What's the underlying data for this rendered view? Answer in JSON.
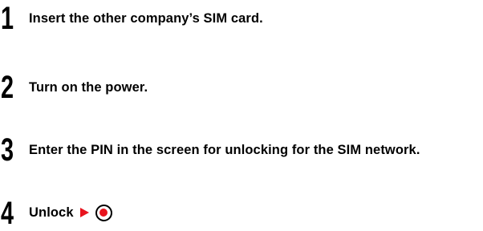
{
  "steps": [
    {
      "number": "1",
      "text": "Insert the other company’s SIM card."
    },
    {
      "number": "2",
      "text": "Turn on the power."
    },
    {
      "number": "3",
      "text": "Enter the PIN in the screen for unlocking for the SIM network."
    },
    {
      "number": "4",
      "text": "Unlock",
      "icons": [
        "arrow-right-icon",
        "center-key-icon"
      ]
    }
  ],
  "colors": {
    "accent": "#e8141e",
    "text": "#000000"
  }
}
